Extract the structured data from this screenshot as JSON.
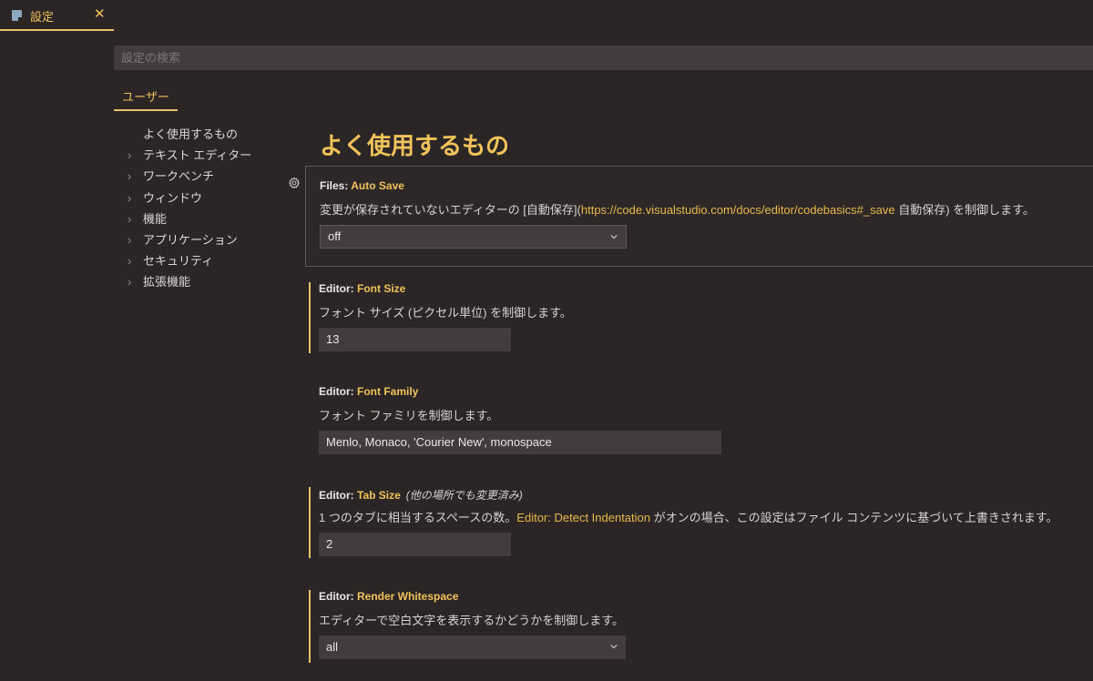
{
  "tab": {
    "title": "設定",
    "icon": "settings-file-icon",
    "close": "✕"
  },
  "search": {
    "placeholder": "設定の検索",
    "value": ""
  },
  "scope_tab": "ユーザー",
  "toc": [
    {
      "label": "よく使用するもの",
      "expandable": false
    },
    {
      "label": "テキスト エディター",
      "expandable": true
    },
    {
      "label": "ワークベンチ",
      "expandable": true
    },
    {
      "label": "ウィンドウ",
      "expandable": true
    },
    {
      "label": "機能",
      "expandable": true
    },
    {
      "label": "アプリケーション",
      "expandable": true
    },
    {
      "label": "セキュリティ",
      "expandable": true
    },
    {
      "label": "拡張機能",
      "expandable": true
    }
  ],
  "chevron": "›",
  "section_title": "よく使用するもの",
  "settings": {
    "auto_save": {
      "category": "Files: ",
      "name": "Auto Save",
      "desc_before": "変更が保存されていないエディターの [自動保存](",
      "desc_link": "https://code.visualstudio.com/docs/editor/codebasics#_save",
      "desc_after": " 自動保存) を制御します。",
      "value": "off"
    },
    "font_size": {
      "category": "Editor: ",
      "name": "Font Size",
      "desc": "フォント サイズ (ピクセル単位) を制御します。",
      "value": "13"
    },
    "font_family": {
      "category": "Editor: ",
      "name": "Font Family",
      "desc": "フォント ファミリを制御します。",
      "value": "Menlo, Monaco, 'Courier New', monospace"
    },
    "tab_size": {
      "category": "Editor: ",
      "name": "Tab Size",
      "note": "(他の場所でも変更済み)",
      "desc_before": "1 つのタブに相当するスペースの数。",
      "desc_link": "Editor: Detect Indentation",
      "desc_after": " がオンの場合、この設定はファイル コンテンツに基づいて上書きされます。",
      "value": "2"
    },
    "render_whitespace": {
      "category": "Editor: ",
      "name": "Render Whitespace",
      "desc": "エディターで空白文字を表示するかどうかを制御します。",
      "value": "all"
    }
  },
  "colors": {
    "accent": "#f0c35a",
    "background": "#2b2526",
    "input": "#433b3c"
  }
}
